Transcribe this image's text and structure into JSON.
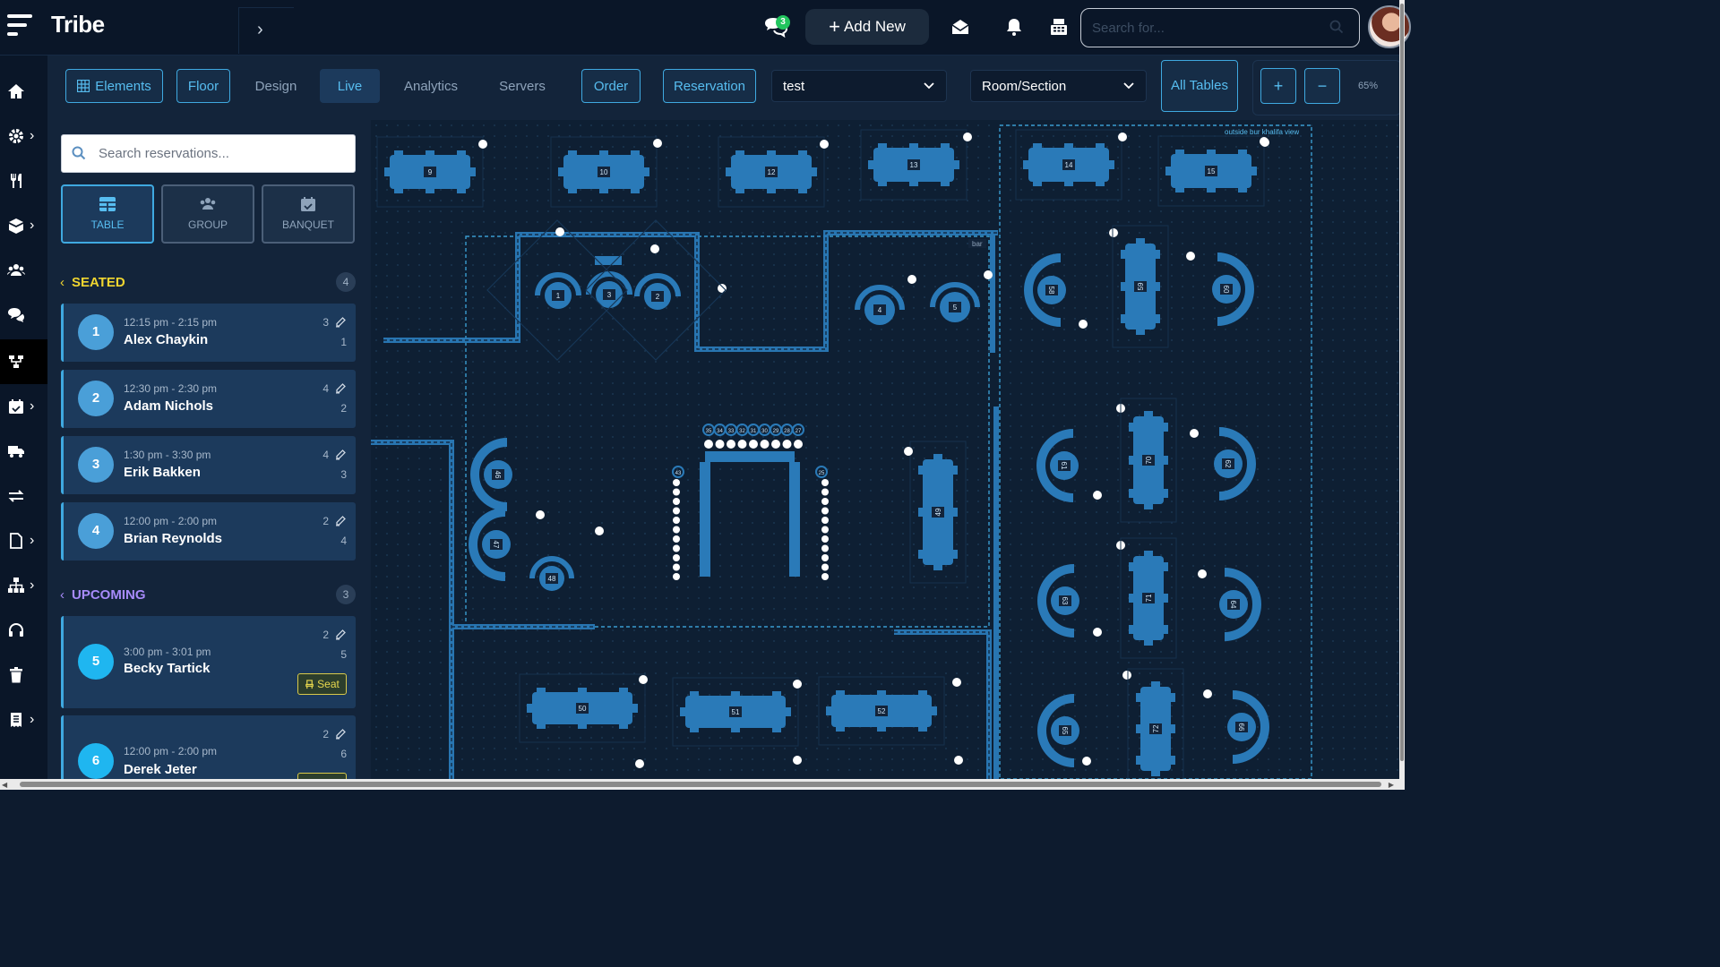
{
  "app": {
    "brand": "Tribe"
  },
  "header": {
    "chat_badge": "3",
    "add_new_label": "Add New",
    "search_placeholder": "Search for..."
  },
  "toolbar": {
    "tabs": [
      {
        "label": "Elements",
        "state": "outlined",
        "icon": "grid-icon"
      },
      {
        "label": "Floor",
        "state": "outlined"
      },
      {
        "label": "Design",
        "state": "plain"
      },
      {
        "label": "Live",
        "state": "filled"
      },
      {
        "label": "Analytics",
        "state": "plain"
      },
      {
        "label": "Servers",
        "state": "plain"
      },
      {
        "label": "Order",
        "state": "outlined"
      },
      {
        "label": "Reservation",
        "state": "outlined"
      }
    ],
    "floor_select": "test",
    "section_select": "Room/Section",
    "all_tables_label": "All Tables",
    "zoom_in": "+",
    "zoom_out": "−",
    "zoom_level": "65%"
  },
  "sidebar": {
    "search_placeholder": "Search reservations...",
    "types": [
      {
        "label": "TABLE",
        "icon": "table-icon",
        "active": true
      },
      {
        "label": "GROUP",
        "icon": "group-icon",
        "active": false
      },
      {
        "label": "BANQUET",
        "icon": "calendar-icon",
        "active": false
      }
    ],
    "seated": {
      "title": "SEATED",
      "count": "4",
      "color": "#f0d530",
      "items": [
        {
          "num": "1",
          "time": "12:15 pm - 2:15 pm",
          "name": "Alex Chaykin",
          "party": "3",
          "table": "1"
        },
        {
          "num": "2",
          "time": "12:30 pm - 2:30 pm",
          "name": "Adam Nichols",
          "party": "4",
          "table": "2"
        },
        {
          "num": "3",
          "time": "1:30 pm - 3:30 pm",
          "name": "Erik Bakken",
          "party": "4",
          "table": "3"
        },
        {
          "num": "4",
          "time": "12:00 pm - 2:00 pm",
          "name": "Brian Reynolds",
          "party": "2",
          "table": "4"
        }
      ]
    },
    "upcoming": {
      "title": "UPCOMING",
      "count": "3",
      "color": "#a78bfa",
      "items": [
        {
          "num": "5",
          "time": "3:00 pm - 3:01 pm",
          "name": "Becky Tartick",
          "party": "2",
          "table": "5",
          "action": "Seat"
        },
        {
          "num": "6",
          "time": "12:00 pm - 2:00 pm",
          "name": "Derek Jeter",
          "party": "2",
          "table": "6"
        }
      ]
    }
  },
  "floor": {
    "area_labels": {
      "outside": "outside bur khalifa view",
      "bar": "bar"
    },
    "tables_top": [
      "9",
      "10",
      "12",
      "13",
      "14",
      "15"
    ],
    "tables_bottom": [
      "50",
      "51",
      "52"
    ],
    "round_tables": [
      "1",
      "3",
      "2",
      "4",
      "5",
      "48"
    ],
    "half_round_tables": [
      "46",
      "47",
      "58",
      "60",
      "61",
      "62",
      "63",
      "64",
      "65",
      "66"
    ],
    "tall_tables": [
      "59",
      "70",
      "71",
      "72",
      "49"
    ],
    "banquet_seat_labels": [
      "35",
      "34",
      "33",
      "32",
      "31",
      "30",
      "29",
      "28",
      "27"
    ],
    "banquet_side_labels": [
      "43",
      "25"
    ]
  },
  "colors": {
    "accent": "#3fa9e0",
    "table_fill": "#2a7ab8",
    "background": "#0d1b2e"
  }
}
